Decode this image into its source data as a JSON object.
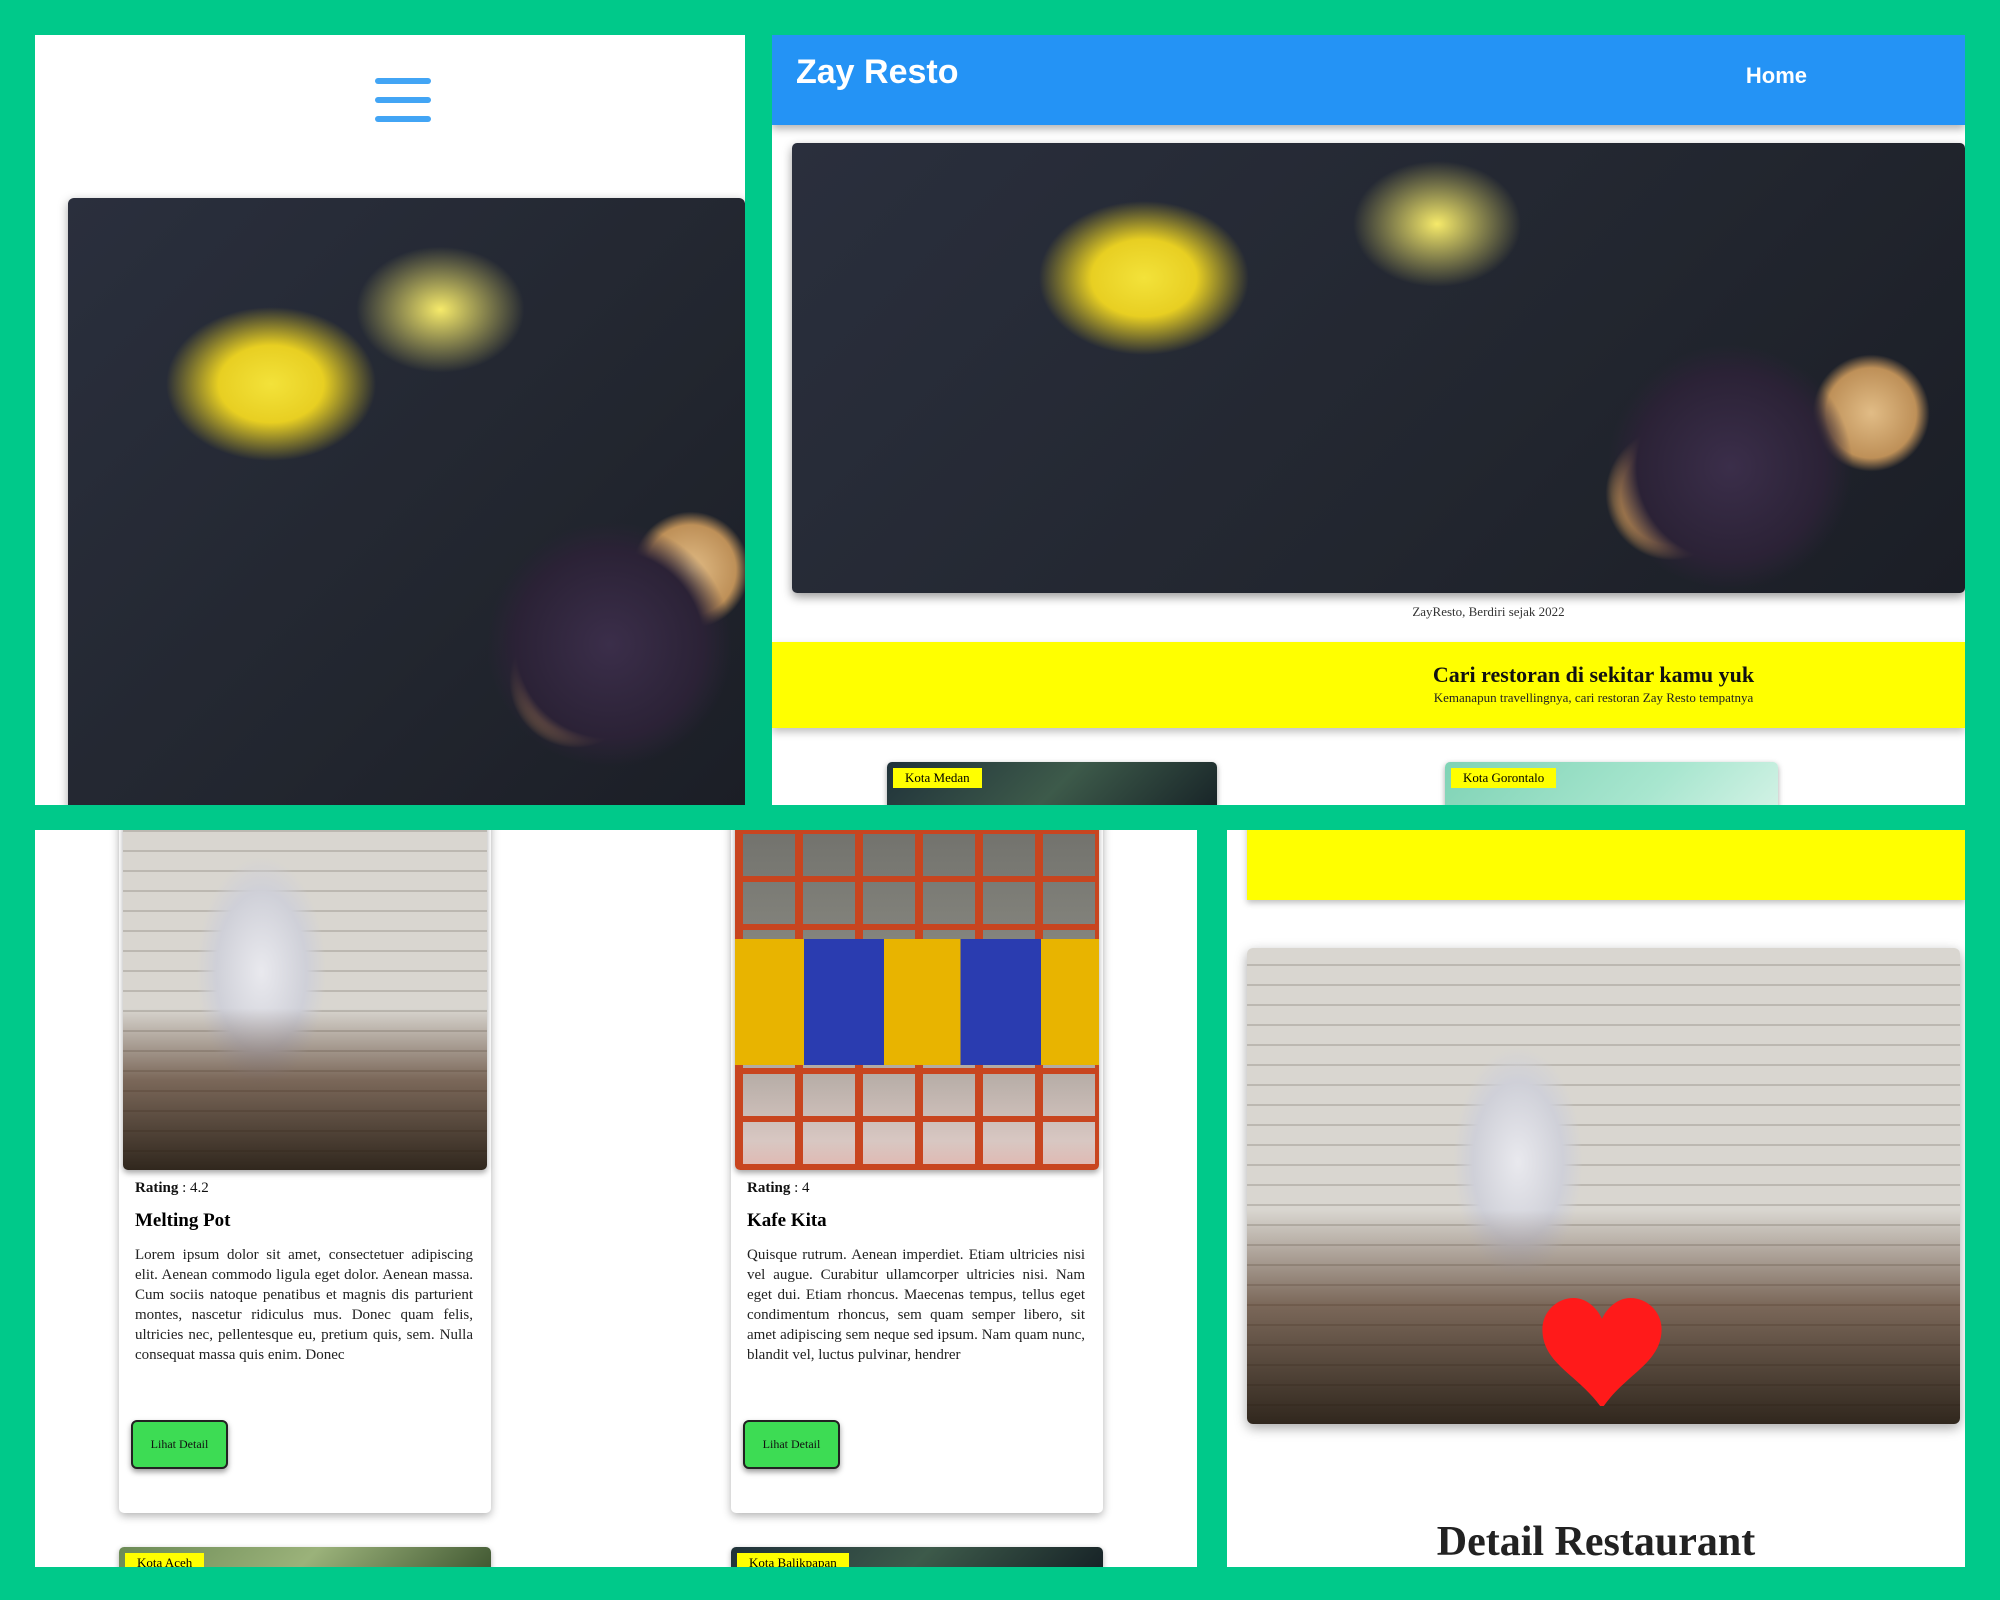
{
  "desktop": {
    "brand": "Zay Resto",
    "nav_home": "Home",
    "hero_caption": "ZayResto, Berdiri sejak 2022",
    "banner_title": "Cari restoran di sekitar kamu yuk",
    "banner_subtitle": "Kemanapun travellingnya, cari restoran Zay Resto tempatnya",
    "cities": [
      "Kota Medan",
      "Kota Gorontalo"
    ]
  },
  "cards": [
    {
      "rating_label": "Rating",
      "rating_value": ": 4.2",
      "name": "Melting Pot",
      "description": "Lorem ipsum dolor sit amet, consectetuer adipiscing elit. Aenean commodo ligula eget dolor. Aenean massa. Cum sociis natoque penatibus et magnis dis parturient montes, nascetur ridiculus mus. Donec quam felis, ultricies nec, pellentesque eu, pretium quis, sem. Nulla consequat massa quis enim. Donec",
      "button": "Lihat Detail"
    },
    {
      "rating_label": "Rating",
      "rating_value": ": 4",
      "name": "Kafe Kita",
      "description": "Quisque rutrum. Aenean imperdiet. Etiam ultricies nisi vel augue. Curabitur ullamcorper ultricies nisi. Nam eget dui. Etiam rhoncus. Maecenas tempus, tellus eget condimentum rhoncus, sem quam semper libero, sit amet adipiscing sem neque sed ipsum. Nam quam nunc, blandit vel, luctus pulvinar, hendrer",
      "button": "Lihat Detail"
    }
  ],
  "next_cities": [
    "Kota Aceh",
    "Kota Balikpapan"
  ],
  "detail": {
    "title": "Detail Restaurant"
  },
  "colors": {
    "page_background": "#00C98A",
    "navbar": "#2493F5",
    "banner": "#FFFF00",
    "button": "#3DDC54",
    "heart": "#FF1A1A",
    "hamburger": "#42A5F5"
  },
  "icons": {
    "menu": "hamburger-menu-icon",
    "favorite": "heart-icon"
  }
}
